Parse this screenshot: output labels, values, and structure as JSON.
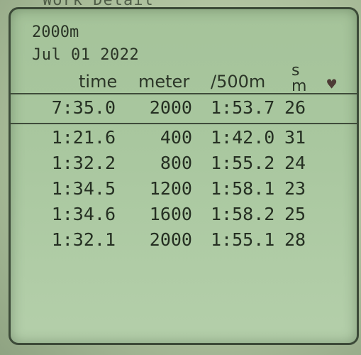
{
  "header": {
    "title_partial": "Work Detail"
  },
  "workout": {
    "distance": "2000m",
    "date": "Jul 01 2022"
  },
  "columns": {
    "time": "time",
    "meter": "meter",
    "split": "/500m",
    "spm_top": "s",
    "spm_bottom": "m",
    "heart_icon": "heart-icon"
  },
  "summary": {
    "time": "7:35.0",
    "meter": "2000",
    "split": "1:53.7",
    "spm": "26"
  },
  "intervals": [
    {
      "time": "1:21.6",
      "meter": "400",
      "split": "1:42.0",
      "spm": "31"
    },
    {
      "time": "1:32.2",
      "meter": "800",
      "split": "1:55.2",
      "spm": "24"
    },
    {
      "time": "1:34.5",
      "meter": "1200",
      "split": "1:58.1",
      "spm": "23"
    },
    {
      "time": "1:34.6",
      "meter": "1600",
      "split": "1:58.2",
      "spm": "25"
    },
    {
      "time": "1:32.1",
      "meter": "2000",
      "split": "1:55.1",
      "spm": "28"
    }
  ]
}
